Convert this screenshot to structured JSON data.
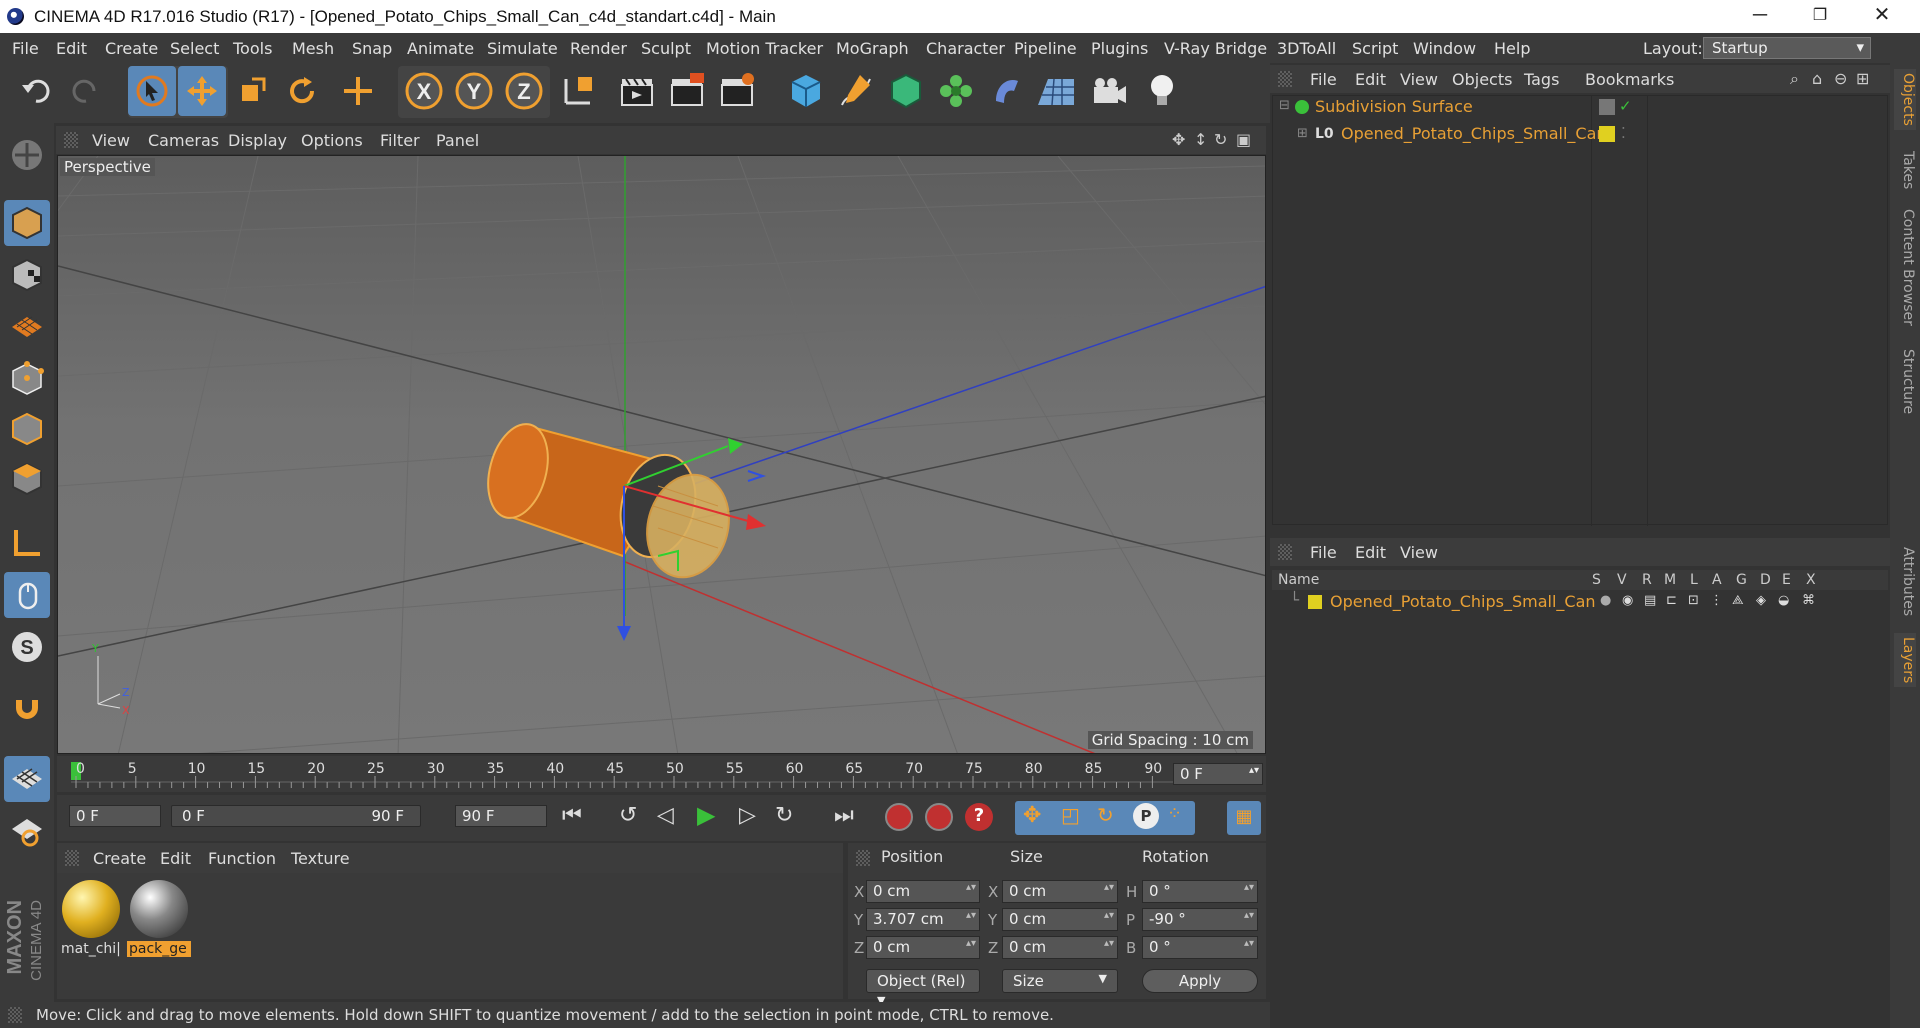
{
  "window": {
    "title": "CINEMA 4D R17.016 Studio (R17) - [Opened_Potato_Chips_Small_Can_c4d_standart.c4d] - Main",
    "minimize": "─",
    "restore": "❐",
    "close": "✕"
  },
  "menubar": {
    "items": [
      "File",
      "Edit",
      "Create",
      "Select",
      "Tools",
      "Mesh",
      "Snap",
      "Animate",
      "Simulate",
      "Render",
      "Sculpt",
      "Motion Tracker",
      "MoGraph",
      "Character",
      "Pipeline",
      "Plugins",
      "V-Ray Bridge",
      "3DToAll",
      "Script",
      "Window",
      "Help"
    ],
    "layout_label": "Layout:",
    "layout_value": "Startup"
  },
  "toolbar": {
    "axis_x": "X",
    "axis_y": "Y",
    "axis_z": "Z"
  },
  "viewport": {
    "menu": [
      "View",
      "Cameras",
      "Display",
      "Options",
      "Filter",
      "Panel"
    ],
    "label": "Perspective",
    "grid_spacing": "Grid Spacing : 10 cm",
    "axis_y": "Y",
    "axis_z": "Z",
    "axis_x": "X"
  },
  "timeline": {
    "ticks": [
      "0",
      "5",
      "10",
      "15",
      "20",
      "25",
      "30",
      "35",
      "40",
      "45",
      "50",
      "55",
      "60",
      "65",
      "70",
      "75",
      "80",
      "85",
      "90"
    ],
    "current_frame": "0 F"
  },
  "transport": {
    "start_field": "0 F",
    "range_start": "0 F",
    "range_end": "90 F",
    "end_field": "90 F"
  },
  "materials": {
    "menu": [
      "Create",
      "Edit",
      "Function",
      "Texture"
    ],
    "items": [
      {
        "name": "mat_chi|"
      },
      {
        "name": "pack_ge"
      }
    ]
  },
  "coords": {
    "headers": [
      "Position",
      "Size",
      "Rotation"
    ],
    "position": [
      {
        "axis": "X",
        "value": "0 cm"
      },
      {
        "axis": "Y",
        "value": "3.707 cm"
      },
      {
        "axis": "Z",
        "value": "0 cm"
      }
    ],
    "size": [
      {
        "axis": "X",
        "value": "0 cm"
      },
      {
        "axis": "Y",
        "value": "0 cm"
      },
      {
        "axis": "Z",
        "value": "0 cm"
      }
    ],
    "rotation": [
      {
        "axis": "H",
        "value": "0 °"
      },
      {
        "axis": "P",
        "value": "-90 °"
      },
      {
        "axis": "B",
        "value": "0 °"
      }
    ],
    "mode": "Object (Rel)",
    "size_mode": "Size",
    "apply": "Apply"
  },
  "status": {
    "text": "Move: Click and drag to move elements. Hold down SHIFT to quantize movement / add to the selection in point mode, CTRL to remove."
  },
  "objects_panel": {
    "menu": [
      "File",
      "Edit",
      "View",
      "Objects",
      "Tags",
      "Bookmarks"
    ],
    "rows": [
      {
        "name": "Subdivision Surface"
      },
      {
        "name": "Opened_Potato_Chips_Small_Can"
      }
    ]
  },
  "layers_panel": {
    "menu": [
      "File",
      "Edit",
      "View"
    ],
    "columns": [
      "Name",
      "S",
      "V",
      "R",
      "M",
      "L",
      "A",
      "G",
      "D",
      "E",
      "X"
    ],
    "row": "Opened_Potato_Chips_Small_Can"
  },
  "side_tabs": [
    "Objects",
    "Takes",
    "Content Browser",
    "Structure",
    "Attributes",
    "Layers"
  ],
  "brand": {
    "line1": "MAXON",
    "line2": "CINEMA 4D"
  },
  "colors": {
    "accent": "#e8a035",
    "active_blue": "#5a88b8",
    "bg": "#333333"
  }
}
